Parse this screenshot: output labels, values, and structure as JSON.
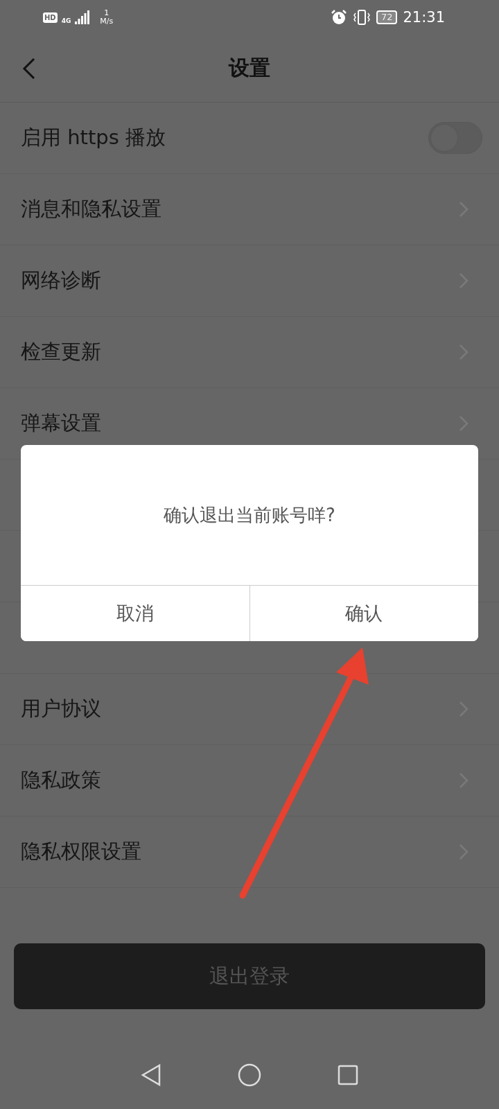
{
  "status_bar": {
    "hd": "HD",
    "network_type": "4G",
    "speed_value": "1",
    "speed_unit": "M/s",
    "battery": "72",
    "time": "21:31"
  },
  "header": {
    "title": "设置"
  },
  "rows": [
    {
      "kind": "toggle",
      "label": "启用 https 播放",
      "on": false
    },
    {
      "kind": "link",
      "label": "消息和隐私设置"
    },
    {
      "kind": "link",
      "label": "网络诊断"
    },
    {
      "kind": "link",
      "label": "检查更新"
    },
    {
      "kind": "link",
      "label": "弹幕设置"
    },
    {
      "kind": "hidden"
    },
    {
      "kind": "hidden"
    },
    {
      "kind": "hidden"
    },
    {
      "kind": "link",
      "label": "用户协议"
    },
    {
      "kind": "link",
      "label": "隐私政策"
    },
    {
      "kind": "link",
      "label": "隐私权限设置"
    }
  ],
  "logout_button": "退出登录",
  "dialog": {
    "message": "确认退出当前账号咩?",
    "buttons": [
      "取消",
      "确认"
    ]
  }
}
